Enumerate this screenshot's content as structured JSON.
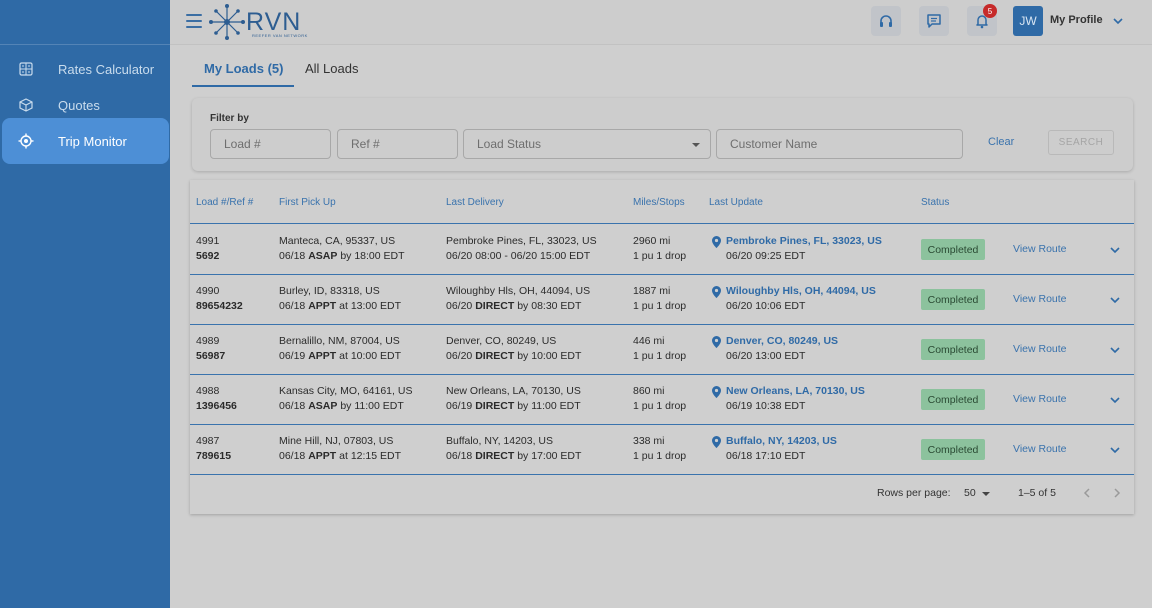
{
  "brand": {
    "name": "RVN",
    "tagline": "REEFER VAN NETWORK"
  },
  "sidebar": {
    "items": [
      {
        "label": "Rates Calculator",
        "icon": "calculator-icon",
        "active": false
      },
      {
        "label": "Quotes",
        "icon": "cube-icon",
        "active": false
      },
      {
        "label": "Trip Monitor",
        "icon": "location-target-icon",
        "active": true
      }
    ]
  },
  "header": {
    "notifications_count": "5",
    "avatar_initials": "JW",
    "profile_label": "My Profile"
  },
  "tabs": [
    {
      "label": "My Loads (5)",
      "active": true
    },
    {
      "label": "All Loads",
      "active": false
    }
  ],
  "filter": {
    "label": "Filter by",
    "load_placeholder": "Load #",
    "ref_placeholder": "Ref #",
    "status_placeholder": "Load Status",
    "customer_placeholder": "Customer Name",
    "clear_label": "Clear",
    "search_label": "SEARCH"
  },
  "table": {
    "columns": [
      "Load #/Ref #",
      "First Pick Up",
      "Last Delivery",
      "Miles/Stops",
      "Last Update",
      "Status"
    ],
    "view_route_label": "View Route",
    "rows": [
      {
        "load": "4991",
        "ref": "5692",
        "pickup_loc": "Manteca, CA, 95337, US",
        "pickup_date": "06/18",
        "pickup_type": "ASAP",
        "pickup_rel": "by 18:00 EDT",
        "delivery_loc": "Pembroke Pines, FL, 33023, US",
        "delivery_time": "06/20 08:00 - 06/20 15:00 EDT",
        "miles": "2960 mi",
        "stops": "1 pu 1 drop",
        "update_loc": "Pembroke Pines, FL, 33023, US",
        "update_time": "06/20 09:25 EDT",
        "status": "Completed"
      },
      {
        "load": "4990",
        "ref": "89654232",
        "pickup_loc": "Burley, ID, 83318, US",
        "pickup_date": "06/18",
        "pickup_type": "APPT",
        "pickup_rel": "at 13:00 EDT",
        "delivery_loc": "Wiloughby Hls, OH, 44094, US",
        "delivery_date": "06/20",
        "delivery_type": "DIRECT",
        "delivery_rel": "by 08:30 EDT",
        "miles": "1887 mi",
        "stops": "1 pu 1 drop",
        "update_loc": "Wiloughby Hls, OH, 44094, US",
        "update_time": "06/20 10:06 EDT",
        "status": "Completed"
      },
      {
        "load": "4989",
        "ref": "56987",
        "pickup_loc": "Bernalillo, NM, 87004, US",
        "pickup_date": "06/19",
        "pickup_type": "APPT",
        "pickup_rel": "at 10:00 EDT",
        "delivery_loc": "Denver, CO, 80249, US",
        "delivery_date": "06/20",
        "delivery_type": "DIRECT",
        "delivery_rel": "by 10:00 EDT",
        "miles": "446 mi",
        "stops": "1 pu 1 drop",
        "update_loc": "Denver, CO, 80249, US",
        "update_time": "06/20 13:00 EDT",
        "status": "Completed"
      },
      {
        "load": "4988",
        "ref": "1396456",
        "pickup_loc": "Kansas City, MO, 64161, US",
        "pickup_date": "06/18",
        "pickup_type": "ASAP",
        "pickup_rel": "by 11:00 EDT",
        "delivery_loc": "New Orleans, LA, 70130, US",
        "delivery_date": "06/19",
        "delivery_type": "DIRECT",
        "delivery_rel": "by 11:00 EDT",
        "miles": "860 mi",
        "stops": "1 pu 1 drop",
        "update_loc": "New Orleans, LA, 70130, US",
        "update_time": "06/19 10:38 EDT",
        "status": "Completed"
      },
      {
        "load": "4987",
        "ref": "789615",
        "pickup_loc": "Mine Hill, NJ, 07803, US",
        "pickup_date": "06/18",
        "pickup_type": "APPT",
        "pickup_rel": "at 12:15 EDT",
        "delivery_loc": "Buffalo, NY, 14203, US",
        "delivery_date": "06/18",
        "delivery_type": "DIRECT",
        "delivery_rel": "by 17:00 EDT",
        "miles": "338 mi",
        "stops": "1 pu 1 drop",
        "update_loc": "Buffalo, NY, 14203, US",
        "update_time": "06/18 17:10 EDT",
        "status": "Completed"
      }
    ]
  },
  "pagination": {
    "rows_per_page_label": "Rows per page:",
    "rows_per_page": "50",
    "range": "1–5 of 5"
  },
  "colors": {
    "primary": "#2f6aa6",
    "sidebar_active": "#4d8fd6",
    "status_completed": "#8cc29d",
    "badge": "#c62a2a"
  }
}
